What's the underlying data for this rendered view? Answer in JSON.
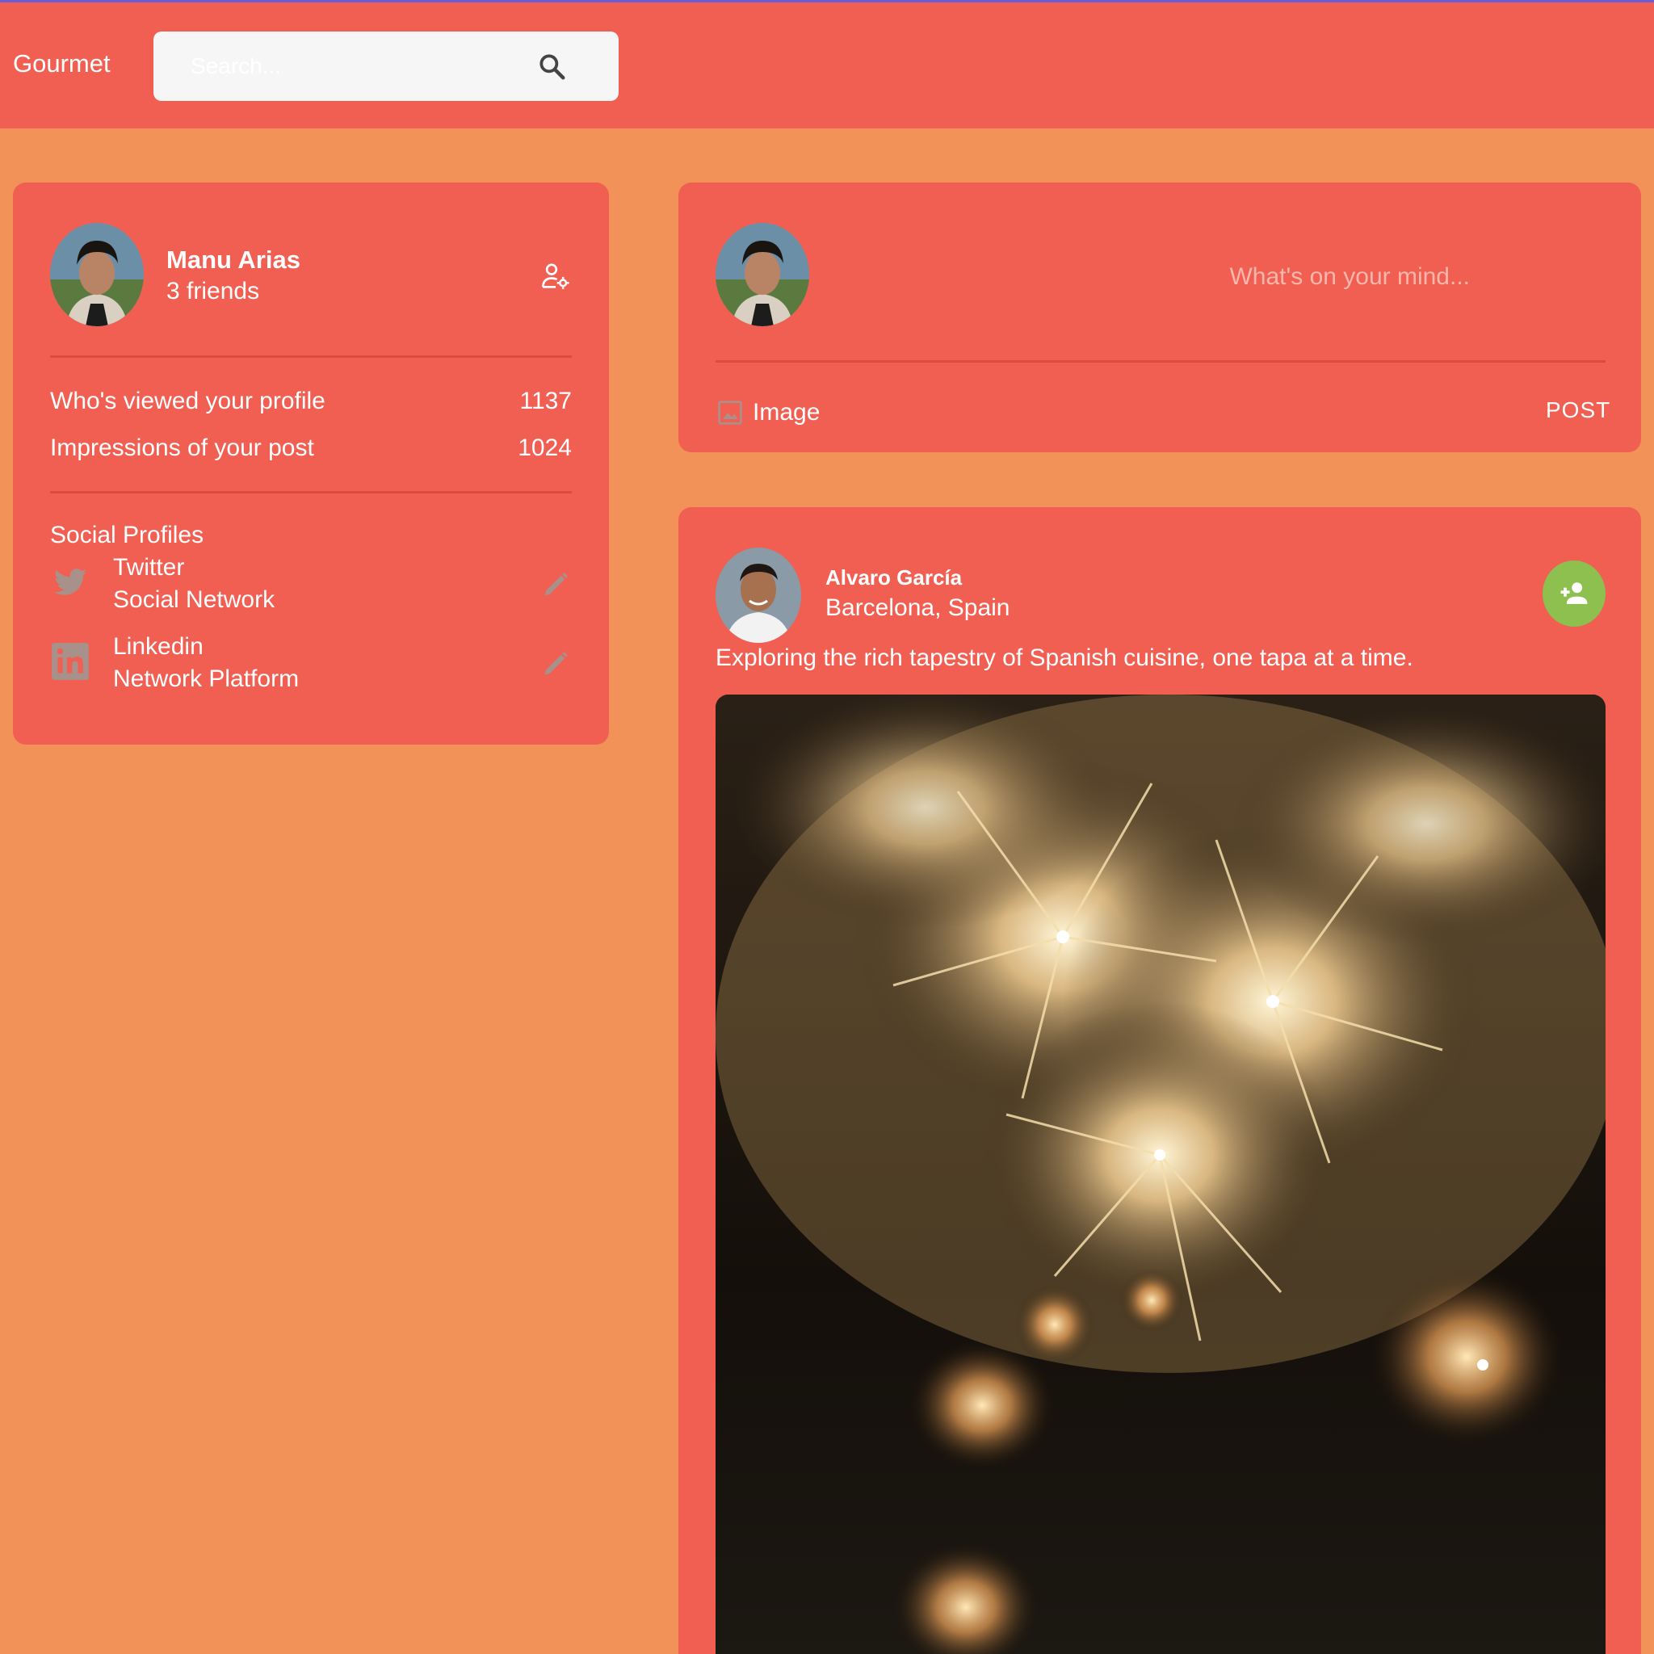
{
  "app": {
    "brand": "Gourmet",
    "search_placeholder": "Search..."
  },
  "profile": {
    "name": "Manu Arias",
    "friends": "3 friends",
    "stats": [
      {
        "label": "Who's viewed your profile",
        "value": "1137"
      },
      {
        "label": "Impressions of your post",
        "value": "1024"
      }
    ],
    "social_heading": "Social Profiles",
    "social": [
      {
        "name": "Twitter",
        "type": "Social Network",
        "icon": "twitter-icon"
      },
      {
        "name": "Linkedin",
        "type": "Network Platform",
        "icon": "linkedin-icon"
      }
    ]
  },
  "composer": {
    "placeholder": "What's on your mind...",
    "image_label": "Image",
    "post_label": "POST"
  },
  "post": {
    "author": "Alvaro García",
    "location": "Barcelona, Spain",
    "text": "Exploring the rich tapestry of Spanish cuisine, one tapa at a time."
  },
  "colors": {
    "background": "#f29158",
    "panel": "#f15f53",
    "accent_green": "#8dc04e"
  }
}
